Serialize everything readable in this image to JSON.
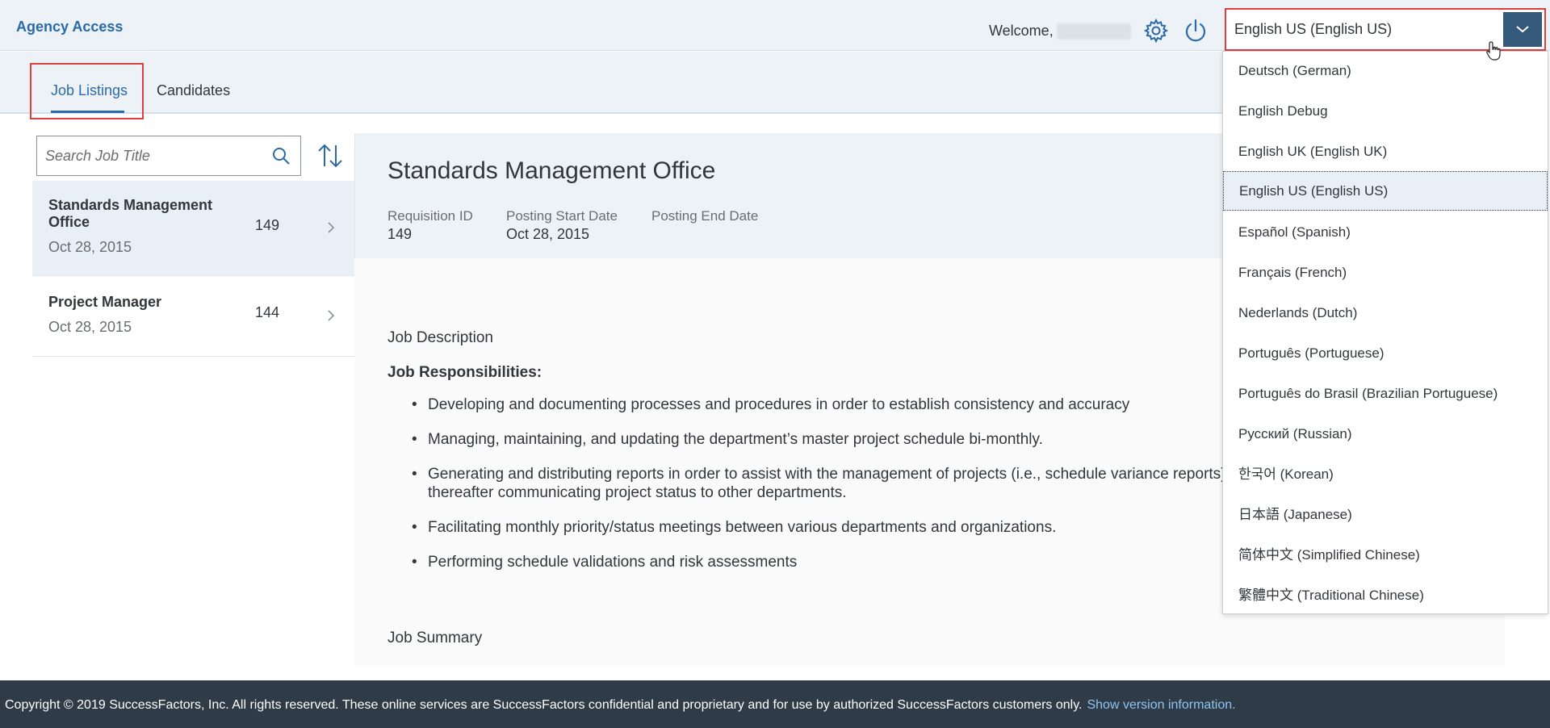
{
  "header": {
    "app_title": "Agency Access",
    "welcome_label": "Welcome,",
    "language_selected": "English US (English US)"
  },
  "languages": [
    "Deutsch (German)",
    "English Debug",
    "English UK (English UK)",
    "English US (English US)",
    "Español (Spanish)",
    "Français (French)",
    "Nederlands (Dutch)",
    "Português (Portuguese)",
    "Português do Brasil (Brazilian Portuguese)",
    "Русский (Russian)",
    "한국어 (Korean)",
    "日本語 (Japanese)",
    "简体中文 (Simplified Chinese)",
    "繁體中文 (Traditional Chinese)"
  ],
  "tabs": {
    "job_listings": "Job Listings",
    "candidates": "Candidates"
  },
  "search": {
    "placeholder": "Search Job Title"
  },
  "jobs": [
    {
      "title": "Standards Management Office",
      "date": "Oct 28, 2015",
      "count": "149"
    },
    {
      "title": "Project Manager",
      "date": "Oct 28, 2015",
      "count": "144"
    }
  ],
  "detail": {
    "title": "Standards Management Office",
    "requisition_label": "Requisition ID",
    "requisition_value": "149",
    "start_label": "Posting Start Date",
    "start_value": "Oct 28, 2015",
    "end_label": "Posting End Date",
    "job_description_heading": "Job Description",
    "responsibilities_heading": "Job Responsibilities:",
    "responsibilities": [
      "Developing and documenting processes and procedures in order to establish consistency and accuracy",
      "Managing, maintaining, and updating the department’s master project schedule bi-monthly.",
      "Generating and distributing reports in order to assist with the management of projects (i.e., schedule variance reports), and thereafter communicating project status to other departments.",
      "Facilitating monthly priority/status meetings between various departments and organizations.",
      "Performing schedule validations and risk assessments"
    ],
    "job_summary_heading": "Job Summary"
  },
  "footer": {
    "copyright": "Copyright © 2019 SuccessFactors, Inc. All rights reserved. These online services are SuccessFactors confidential and proprietary and for use by authorized SuccessFactors customers only.",
    "version_link": "Show version information."
  }
}
